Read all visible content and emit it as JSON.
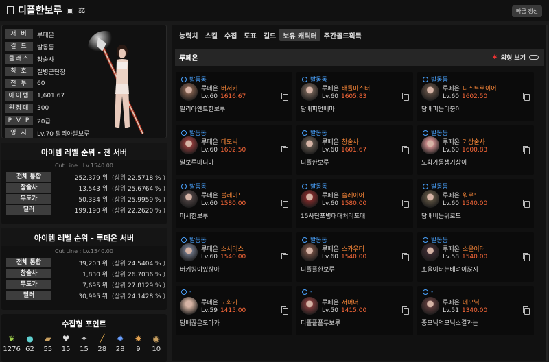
{
  "header": {
    "title": "디플한보루",
    "update_label": "빠금 갱신"
  },
  "profile": {
    "rows": [
      {
        "label": "서 버",
        "value": "루페온"
      },
      {
        "label": "길 드",
        "value": "발동동"
      },
      {
        "label": "클래스",
        "value": "창술사"
      },
      {
        "label": "칭 호",
        "value": "질병군단장"
      },
      {
        "label": "전 투",
        "value": "60"
      },
      {
        "label": "아이템",
        "value": "1,601.67"
      },
      {
        "label": "원정대",
        "value": "300"
      },
      {
        "label": "P V P",
        "value": "20급"
      },
      {
        "label": "영 지",
        "value": "Lv.70 팔리아말보루"
      }
    ]
  },
  "rank_all": {
    "title": "아이템 레벨 순위 - 전 서버",
    "cutline": "Cut Line : Lv.1540.00",
    "rows": [
      {
        "label": "전체 통합",
        "rank": "252,379 위",
        "pct": "22.5718 %"
      },
      {
        "label": "창술사",
        "rank": "13,543 위",
        "pct": "25.6764 %"
      },
      {
        "label": "무도가",
        "rank": "50,334 위",
        "pct": "25.9959 %"
      },
      {
        "label": "딜러",
        "rank": "199,190 위",
        "pct": "22.2620 %"
      }
    ]
  },
  "rank_server": {
    "title": "아이템 레벨 순위 - 루페온 서버",
    "cutline": "Cut Line : Lv.1540.00",
    "rows": [
      {
        "label": "전체 통합",
        "rank": "39,203 위",
        "pct": "24.5404 %"
      },
      {
        "label": "창술사",
        "rank": "1,830 위",
        "pct": "26.7036 %"
      },
      {
        "label": "무도가",
        "rank": "7,695 위",
        "pct": "27.8129 %"
      },
      {
        "label": "딜러",
        "rank": "30,995 위",
        "pct": "24.1428 %"
      }
    ]
  },
  "rank_labels": {
    "upper_open": "(상위",
    "close": ")"
  },
  "collect": {
    "title": "수집형 포인트",
    "items": [
      {
        "icon": "seed-icon",
        "count": "1276"
      },
      {
        "icon": "island-heart-icon",
        "count": "62"
      },
      {
        "icon": "art-icon",
        "count": "55"
      },
      {
        "icon": "giant-heart-icon",
        "count": "15"
      },
      {
        "icon": "ignea-icon",
        "count": "15"
      },
      {
        "icon": "worldtree-leaf-icon",
        "count": "28"
      },
      {
        "icon": "orpheus-star-icon",
        "count": "28"
      },
      {
        "icon": "mococo-icon",
        "count": "9"
      },
      {
        "icon": "medal-icon",
        "count": "10"
      }
    ]
  },
  "tabs": [
    "능력치",
    "스킬",
    "수집",
    "도표",
    "길드",
    "보유 캐릭터",
    "주간골드획득"
  ],
  "server_bar": {
    "server": "루페온",
    "look_label": "외형 보기"
  },
  "characters": [
    {
      "guild": "발동동",
      "server": "루페온",
      "class": "버서커",
      "level": "Lv.60",
      "ilvl": "1616.67",
      "name": "팔리아엔트한보루"
    },
    {
      "guild": "발동동",
      "server": "루페온",
      "class": "배틀마스터",
      "level": "Lv.60",
      "ilvl": "1605.83",
      "name": "담배피던배마"
    },
    {
      "guild": "발동동",
      "server": "루페온",
      "class": "디스트로이어",
      "level": "Lv.60",
      "ilvl": "1602.50",
      "name": "담배피는디붕이"
    },
    {
      "guild": "발동동",
      "server": "루페온",
      "class": "데모닉",
      "level": "Lv.60",
      "ilvl": "1602.50",
      "name": "말보루마니아"
    },
    {
      "guild": "발동동",
      "server": "루페온",
      "class": "창술사",
      "level": "Lv.60",
      "ilvl": "1601.67",
      "name": "디플한보루"
    },
    {
      "guild": "발동동",
      "server": "루페온",
      "class": "기상술사",
      "level": "Lv.60",
      "ilvl": "1600.83",
      "name": "도화가동생기상이"
    },
    {
      "guild": "발동동",
      "server": "루페온",
      "class": "블레이드",
      "level": "Lv.60",
      "ilvl": "1580.00",
      "name": "마세한보루"
    },
    {
      "guild": "발동동",
      "server": "루페온",
      "class": "슬레이어",
      "level": "Lv.60",
      "ilvl": "1580.00",
      "name": "15사단포병대대처리포대"
    },
    {
      "guild": "발동동",
      "server": "루페온",
      "class": "워로드",
      "level": "Lv.60",
      "ilvl": "1540.00",
      "name": "담배비는워로드"
    },
    {
      "guild": "발동동",
      "server": "루페온",
      "class": "소서리스",
      "level": "Lv.60",
      "ilvl": "1540.00",
      "name": "버커킹이있잖아"
    },
    {
      "guild": "발동동",
      "server": "루페온",
      "class": "스카우터",
      "level": "Lv.60",
      "ilvl": "1540.00",
      "name": "디플플한보루"
    },
    {
      "guild": "발동동",
      "server": "루페온",
      "class": "소울이터",
      "level": "Lv.58",
      "ilvl": "1540.00",
      "name": "소울이터는배려이잖지"
    },
    {
      "guild": "-",
      "server": "루페온",
      "class": "도화가",
      "level": "Lv.59",
      "ilvl": "1415.00",
      "name": "담배끊은도아가"
    },
    {
      "guild": "-",
      "server": "루페온",
      "class": "서머너",
      "level": "Lv.50",
      "ilvl": "1415.00",
      "name": "디플플플두보루"
    },
    {
      "guild": "-",
      "server": "루페온",
      "class": "데모닉",
      "level": "Lv.51",
      "ilvl": "1340.00",
      "name": "중모닉억모닉소결과는"
    }
  ],
  "colors": {
    "guild": "#4aa3ff",
    "class": "#ff8a3a",
    "ilvl": "#ff6a3a",
    "look_dot": "#ee3333"
  }
}
